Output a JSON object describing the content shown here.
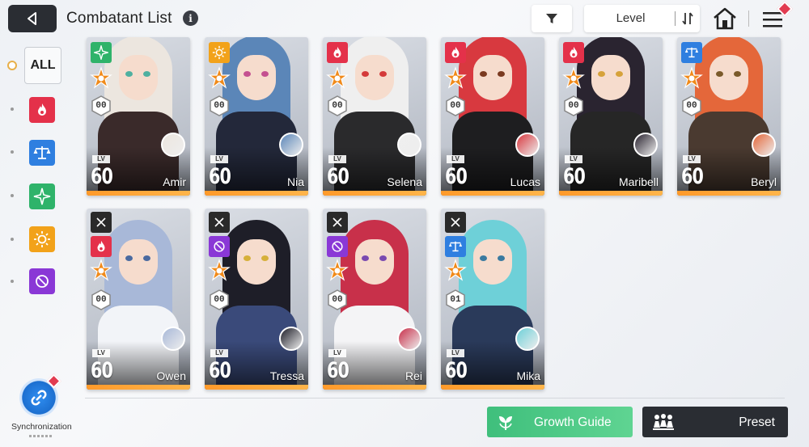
{
  "header": {
    "title": "Combatant List",
    "sort_label": "Level"
  },
  "sidebar": {
    "all_label": "ALL",
    "filters": [
      {
        "name": "fire-attribute",
        "color": "#e4314a"
      },
      {
        "name": "order-attribute",
        "color": "#2f7fe0"
      },
      {
        "name": "wind-attribute",
        "color": "#2fb36a"
      },
      {
        "name": "light-attribute",
        "color": "#f2a21a"
      },
      {
        "name": "void-attribute",
        "color": "#8a38d6"
      }
    ],
    "sync_label": "Synchronization"
  },
  "colors": {
    "fire": "#e4314a",
    "order": "#2f7fe0",
    "wind": "#2fb36a",
    "light": "#f2a21a",
    "void": "#8a38d6",
    "accent_orange": "#ff9a2a",
    "growth_green": "#47c582",
    "dark": "#2a2d33"
  },
  "characters": [
    {
      "name": "Amir",
      "level": "60",
      "lv_label": "LV",
      "dupes": "00",
      "attribute": "wind",
      "hair": "#ece6df",
      "outfit": "#3a2a2a",
      "eye": "#4fb0a0",
      "skin": "#b98468"
    },
    {
      "name": "Nia",
      "level": "60",
      "lv_label": "LV",
      "dupes": "00",
      "attribute": "light",
      "hair": "#5b86b8",
      "outfit": "#23283a",
      "eye": "#c45090",
      "skin": "#f6dccd"
    },
    {
      "name": "Selena",
      "level": "60",
      "lv_label": "LV",
      "dupes": "00",
      "attribute": "fire",
      "hair": "#efefef",
      "outfit": "#2a2a2c",
      "eye": "#d43a3a",
      "skin": "#f6dccd"
    },
    {
      "name": "Lucas",
      "level": "60",
      "lv_label": "LV",
      "dupes": "00",
      "attribute": "fire",
      "hair": "#d8393f",
      "outfit": "#1e1e20",
      "eye": "#7a3a20",
      "skin": "#f3d6c4"
    },
    {
      "name": "Maribell",
      "level": "60",
      "lv_label": "LV",
      "dupes": "00",
      "attribute": "fire",
      "hair": "#2a2430",
      "outfit": "#262626",
      "eye": "#d6a23a",
      "skin": "#f6dccd"
    },
    {
      "name": "Beryl",
      "level": "60",
      "lv_label": "LV",
      "dupes": "00",
      "attribute": "order",
      "hair": "#e4673a",
      "outfit": "#4a3a30",
      "eye": "#7a5a2a",
      "skin": "#f6dccd"
    },
    {
      "name": "Owen",
      "level": "60",
      "lv_label": "LV",
      "dupes": "00",
      "attribute": "fire",
      "hair": "#a8b8d8",
      "outfit": "#f2f4f8",
      "eye": "#4a6aa0",
      "skin": "#f6dccd"
    },
    {
      "name": "Tressa",
      "level": "60",
      "lv_label": "LV",
      "dupes": "00",
      "attribute": "void",
      "hair": "#1e1e28",
      "outfit": "#3a4a7a",
      "eye": "#d6b03a",
      "skin": "#f6dccd"
    },
    {
      "name": "Rei",
      "level": "60",
      "lv_label": "LV",
      "dupes": "00",
      "attribute": "void",
      "hair": "#c8304a",
      "outfit": "#f4f4f6",
      "eye": "#7a4ab0",
      "skin": "#f6dccd"
    },
    {
      "name": "Mika",
      "level": "60",
      "lv_label": "LV",
      "dupes": "01",
      "attribute": "order",
      "hair": "#6ed0d8",
      "outfit": "#2a3a5a",
      "eye": "#3a7aa0",
      "skin": "#f6dccd"
    }
  ],
  "footer": {
    "growth_label": "Growth Guide",
    "preset_label": "Preset"
  }
}
